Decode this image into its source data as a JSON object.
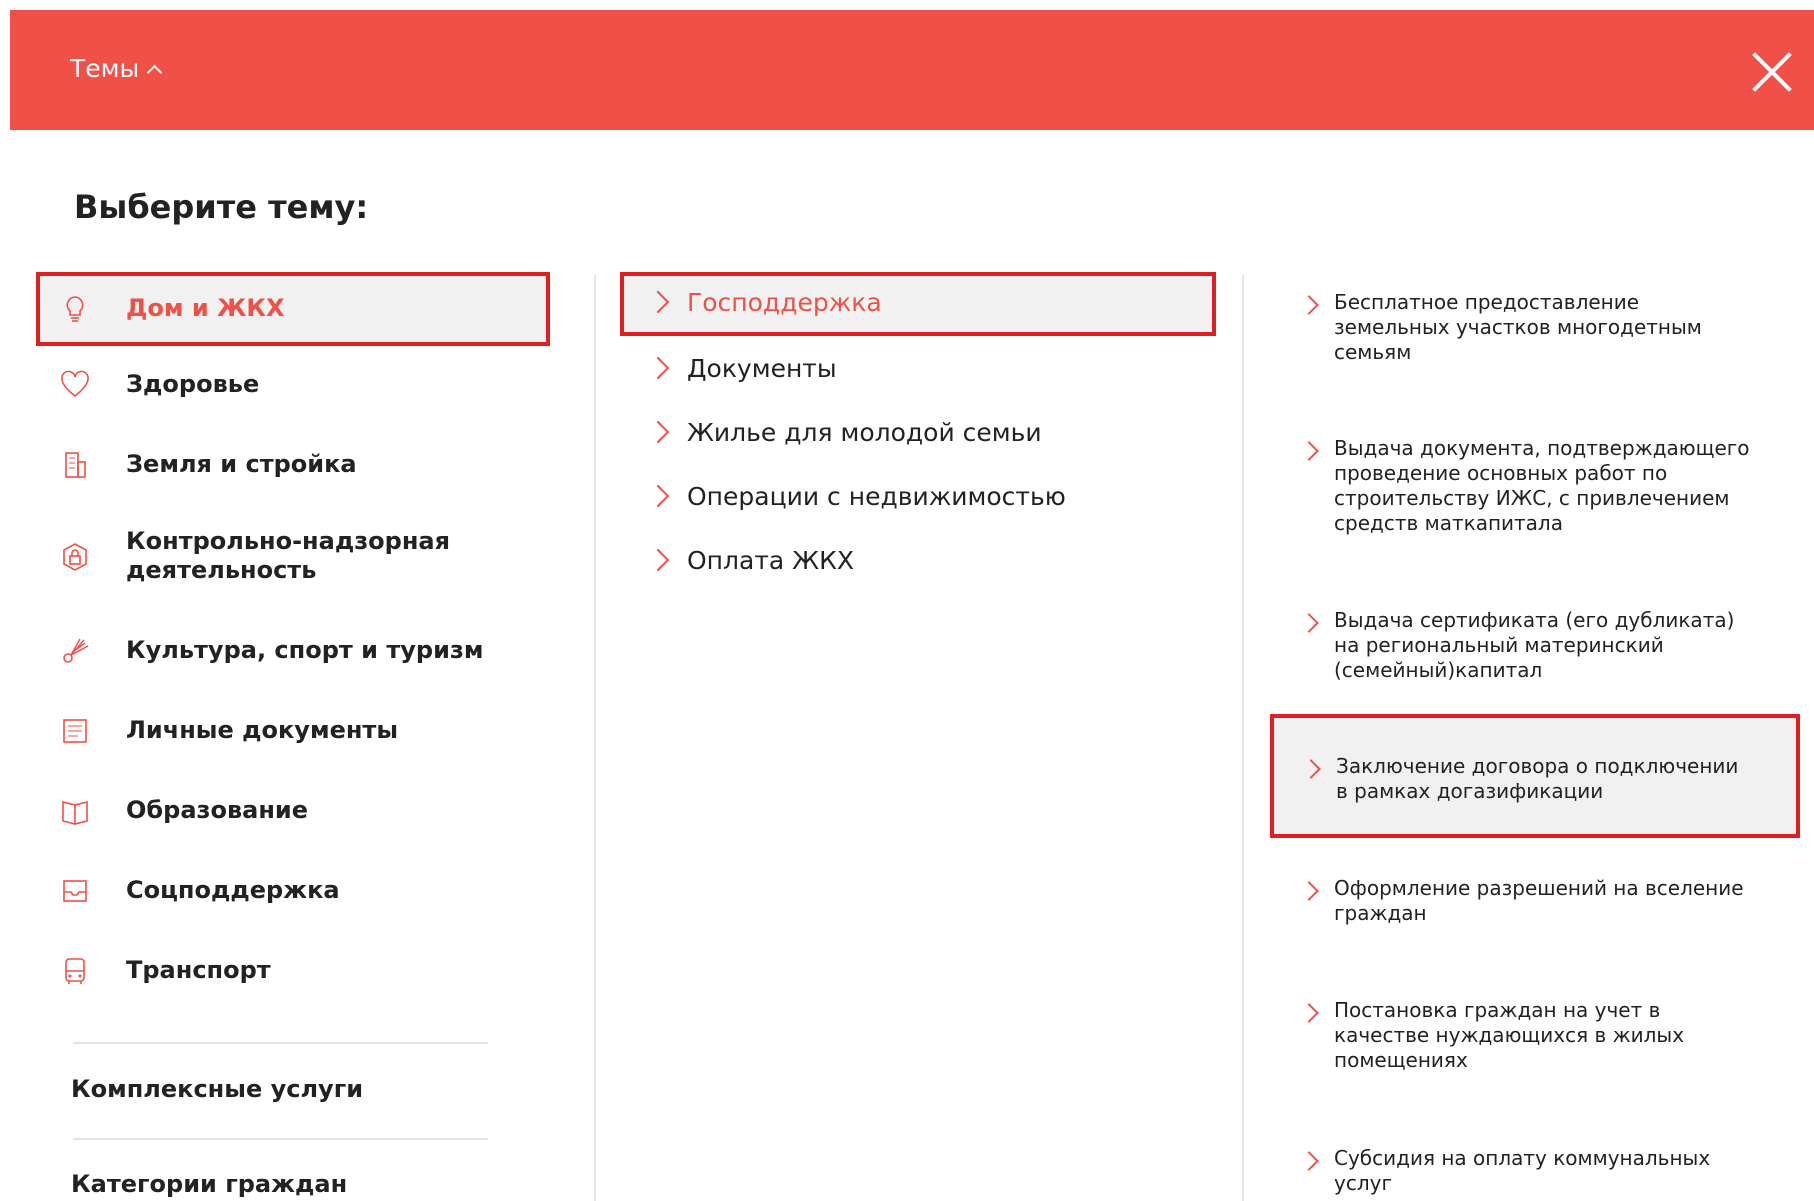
{
  "header": {
    "title": "Темы",
    "accent_color": "#f05048",
    "chevron_icon": "chevron-up-icon",
    "close_icon": "close-icon"
  },
  "heading": "Выберите тему:",
  "categories": [
    {
      "label": "Дом и ЖКХ",
      "icon": "lightbulb-icon"
    },
    {
      "label": "Здоровье",
      "icon": "heart-icon"
    },
    {
      "label": "Земля и стройка",
      "icon": "building-icon"
    },
    {
      "label": "Контрольно-надзорная деятельность",
      "icon": "badge-lock-icon"
    },
    {
      "label": "Культура, спорт и туризм",
      "icon": "shuttlecock-icon"
    },
    {
      "label": "Личные документы",
      "icon": "document-icon"
    },
    {
      "label": "Образование",
      "icon": "book-icon"
    },
    {
      "label": "Соцподдержка",
      "icon": "inbox-icon"
    },
    {
      "label": "Транспорт",
      "icon": "bus-icon"
    }
  ],
  "extra_links": [
    "Комплексные услуги",
    "Категории граждан"
  ],
  "subcategories": [
    "Господдержка",
    "Документы",
    "Жилье для молодой семьи",
    "Операции с недвижимостью",
    "Оплата ЖКХ"
  ],
  "services": [
    "Бесплатное предоставление земельных участков многодетным семьям",
    "Выдача документа, подтверждающего проведение основных работ по строительству ИЖС, с привлечением средств маткапитала",
    "Выдача сертификата (его дубликата) на региональный материнский (семейный)капитал",
    "Заключение договора о подключении в рамках догазификации",
    "Оформление разрешений на вселение граждан",
    "Постановка граждан на учет в качестве нуждающихся в жилых помещениях",
    "Субсидия на оплату коммунальных услуг"
  ],
  "selection": {
    "active_category": "Дом и ЖКХ",
    "active_subcategory": "Господдержка",
    "active_service": "Заключение договора о подключении в рамках догазификации",
    "highlight_color": "#e02020"
  }
}
